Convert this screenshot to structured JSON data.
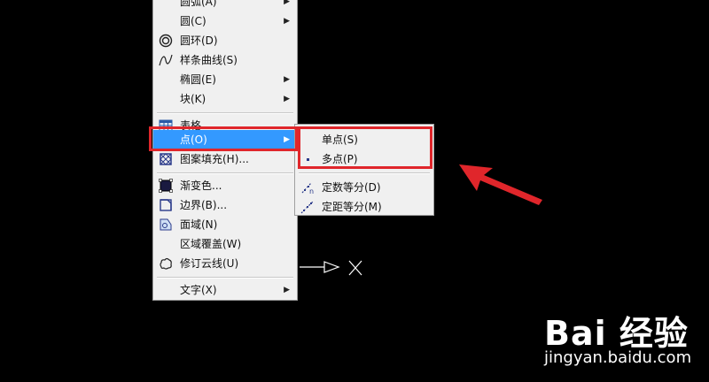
{
  "main_menu": {
    "items_top": [
      {
        "label": "圆弧(A)",
        "arrow": true
      },
      {
        "label": "圆(C)",
        "arrow": true
      },
      {
        "label": "圆环(D)",
        "icon": "donut-icon"
      },
      {
        "label": "样条曲线(S)",
        "icon": "spline-icon"
      },
      {
        "label": "椭圆(E)",
        "arrow": true
      },
      {
        "label": "块(K)",
        "arrow": true
      }
    ],
    "table": {
      "label": "表格...",
      "icon": "table-icon"
    },
    "point": {
      "label": "点(O)",
      "arrow": true
    },
    "hatch": {
      "label": "图案填充(H)...",
      "icon": "hatch-icon"
    },
    "gradient": {
      "label": "渐变色...",
      "icon": "gradient-icon"
    },
    "boundary": {
      "label": "边界(B)...",
      "icon": "boundary-icon"
    },
    "region": {
      "label": "面域(N)",
      "icon": "region-icon"
    },
    "wipeout": {
      "label": "区域覆盖(W)"
    },
    "revcloud": {
      "label": "修订云线(U)",
      "icon": "revcloud-icon"
    },
    "text": {
      "label": "文字(X)",
      "arrow": true
    }
  },
  "sub_menu": {
    "single_point": "单点(S)",
    "multiple_point": "多点(P)",
    "divide": "定数等分(D)",
    "measure": "定距等分(M)"
  },
  "watermark": {
    "brand": "Bai 经验",
    "url": "jingyan.baidu.com"
  },
  "colors": {
    "highlight": "#3399ff",
    "annotation_red": "#e0262b",
    "canvas": "#000000"
  }
}
